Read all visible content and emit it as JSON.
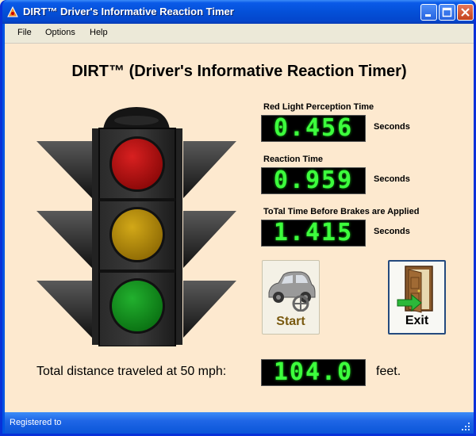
{
  "window": {
    "title": "DIRT™ Driver's Informative Reaction Timer"
  },
  "menu": [
    "File",
    "Options",
    "Help"
  ],
  "main": {
    "heading": "DIRT™ (Driver's Informative Reaction Timer)",
    "perception": {
      "label": "Red Light Perception Time",
      "value": "0.456",
      "unit": "Seconds"
    },
    "reaction": {
      "label": "Reaction Time",
      "value": "0.959",
      "unit": "Seconds"
    },
    "total": {
      "label": "ToTal Time Before Brakes are Applied",
      "value": "1.415",
      "unit": "Seconds"
    },
    "start_label": "Start",
    "exit_label": "Exit",
    "distance": {
      "label": "Total distance traveled at 50 mph:",
      "value": "104.0",
      "unit": "feet."
    }
  },
  "status": {
    "text": "Registered to"
  },
  "colors": {
    "lcd_text": "#3dff3d",
    "red_lamp": "#b01010",
    "yellow_lamp": "#b8900c",
    "green_lamp": "#129a1e",
    "client_bg": "#fde9cf"
  }
}
